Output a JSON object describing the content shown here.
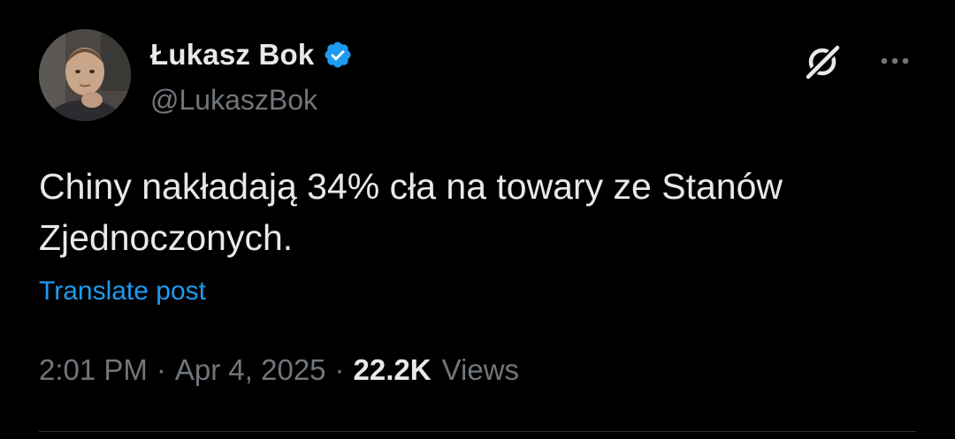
{
  "author": {
    "display_name": "Łukasz Bok",
    "handle": "@LukaszBok",
    "verified": true,
    "avatar_icon": "user-avatar-photo"
  },
  "actions": {
    "grok_icon": "grok-icon",
    "more_icon": "more-dots-icon"
  },
  "tweet": {
    "text": "Chiny nakładają 34% cła na towary ze Stanów\nZjednoczonych.",
    "translate_label": "Translate post"
  },
  "meta": {
    "time": "2:01 PM",
    "separator": "·",
    "date": "Apr 4, 2025",
    "views_count": "22.2K",
    "views_label": "Views"
  },
  "colors": {
    "background": "#000000",
    "text": "#e7e9ea",
    "muted": "#71767b",
    "link": "#1d9bf0",
    "verified": "#1d9bf0"
  }
}
